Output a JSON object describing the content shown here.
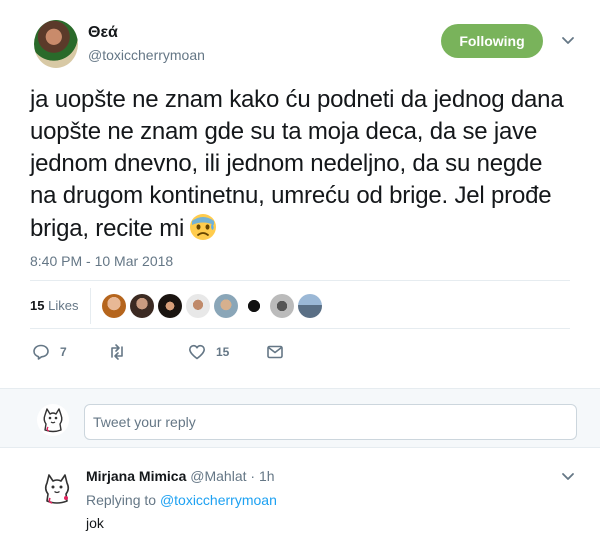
{
  "tweet": {
    "display_name": "Θεά",
    "screen_name": "@toxiccherrymoan",
    "follow_label": "Following",
    "text": "ja uopšte ne znam kako ću podneti da jednog dana uopšte ne znam gde su ta moja deca, da se jave jednom dnevno, ili jednom nedeljno, da su negde na drugom kontinetnu, umreću od brige. Jel prođe briga, recite mi",
    "emoji": "anxious-face-with-sweat",
    "timestamp": "8:40 PM - 10 Mar 2018"
  },
  "likes": {
    "count": "15",
    "label": "Likes",
    "avatars": [
      "liker-1",
      "liker-2",
      "liker-3",
      "liker-4",
      "liker-5",
      "liker-6",
      "liker-7",
      "liker-8"
    ]
  },
  "actions": {
    "reply_count": "7",
    "retweet_count": "",
    "like_count": "15"
  },
  "reply_box": {
    "placeholder": "Tweet your reply"
  },
  "reply": {
    "name": "Mirjana Mimica",
    "handle": "@Mahlat",
    "time": "· 1h",
    "replying_prefix": "Replying to",
    "replying_to": "@toxiccherrymoan",
    "text": "jok"
  },
  "colors": {
    "follow_green": "#79b35b",
    "link_blue": "#1da1f2",
    "muted": "#657786"
  }
}
